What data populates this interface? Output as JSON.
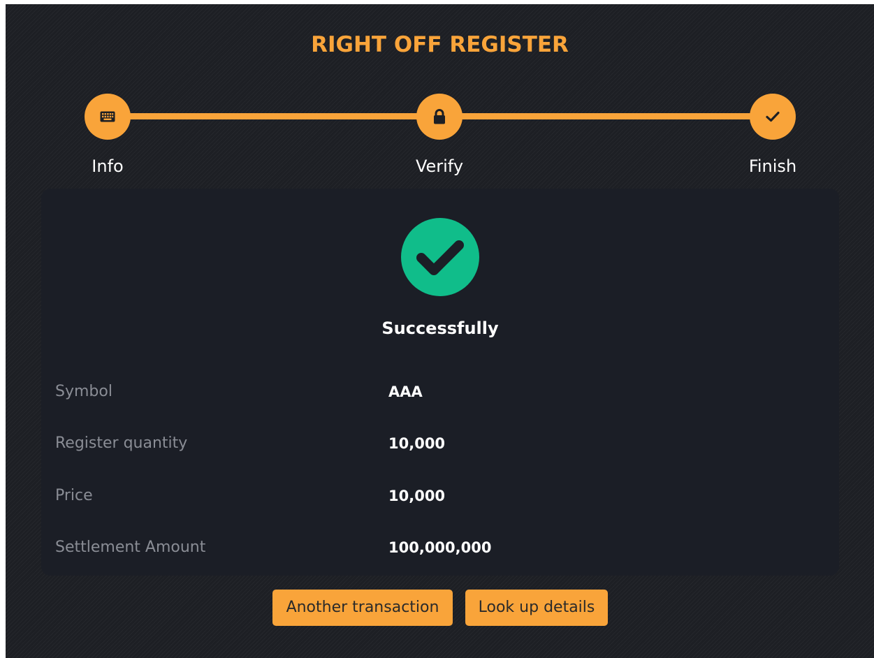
{
  "page": {
    "title": "RIGHT OFF REGISTER"
  },
  "stepper": {
    "steps": [
      {
        "label": "Info",
        "icon": "keyboard-icon"
      },
      {
        "label": "Verify",
        "icon": "lock-icon"
      },
      {
        "label": "Finish",
        "icon": "check-icon"
      }
    ]
  },
  "result": {
    "status": "Successfully",
    "icon": "check-circle-icon",
    "rows": [
      {
        "label": "Symbol",
        "value": "AAA"
      },
      {
        "label": "Register quantity",
        "value": "10,000"
      },
      {
        "label": "Price",
        "value": "10,000"
      },
      {
        "label": "Settlement Amount",
        "value": "100,000,000"
      }
    ]
  },
  "actions": {
    "another_transaction": "Another transaction",
    "look_up_details": "Look up details"
  },
  "colors": {
    "accent": "#f9a43a",
    "success": "#10bd8a",
    "background": "#1d1f24",
    "card": "#1b1e26"
  }
}
